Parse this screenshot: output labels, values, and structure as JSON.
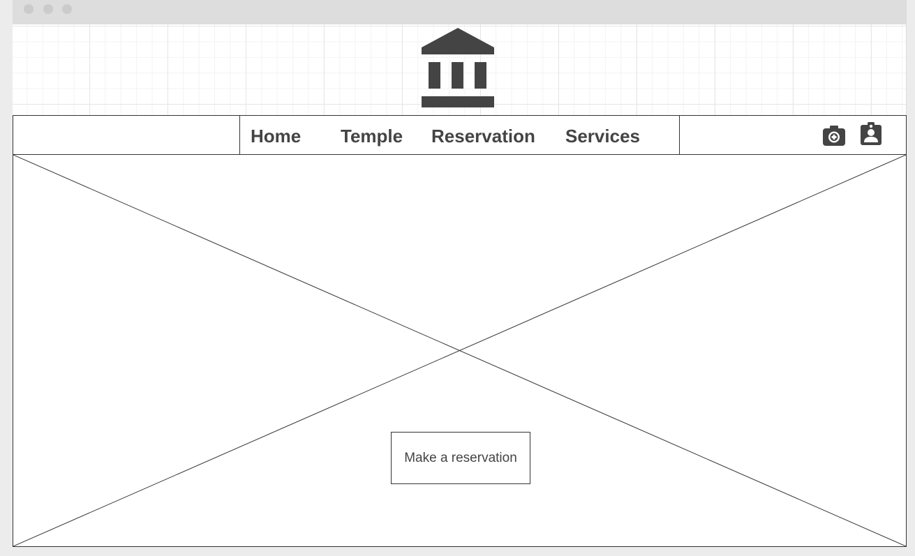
{
  "nav": {
    "items": [
      {
        "label": "Home"
      },
      {
        "label": "Temple"
      },
      {
        "label": "Reservation"
      },
      {
        "label": "Services"
      }
    ]
  },
  "icons": {
    "logo": "bank-building-icon",
    "camera": "camera-icon",
    "profile": "id-badge-icon"
  },
  "hero": {
    "cta_label": "Make a reservation"
  },
  "colors": {
    "ink": "#444444",
    "line": "#333333",
    "titlebar": "#dddddd",
    "page_bg": "#ececec"
  }
}
